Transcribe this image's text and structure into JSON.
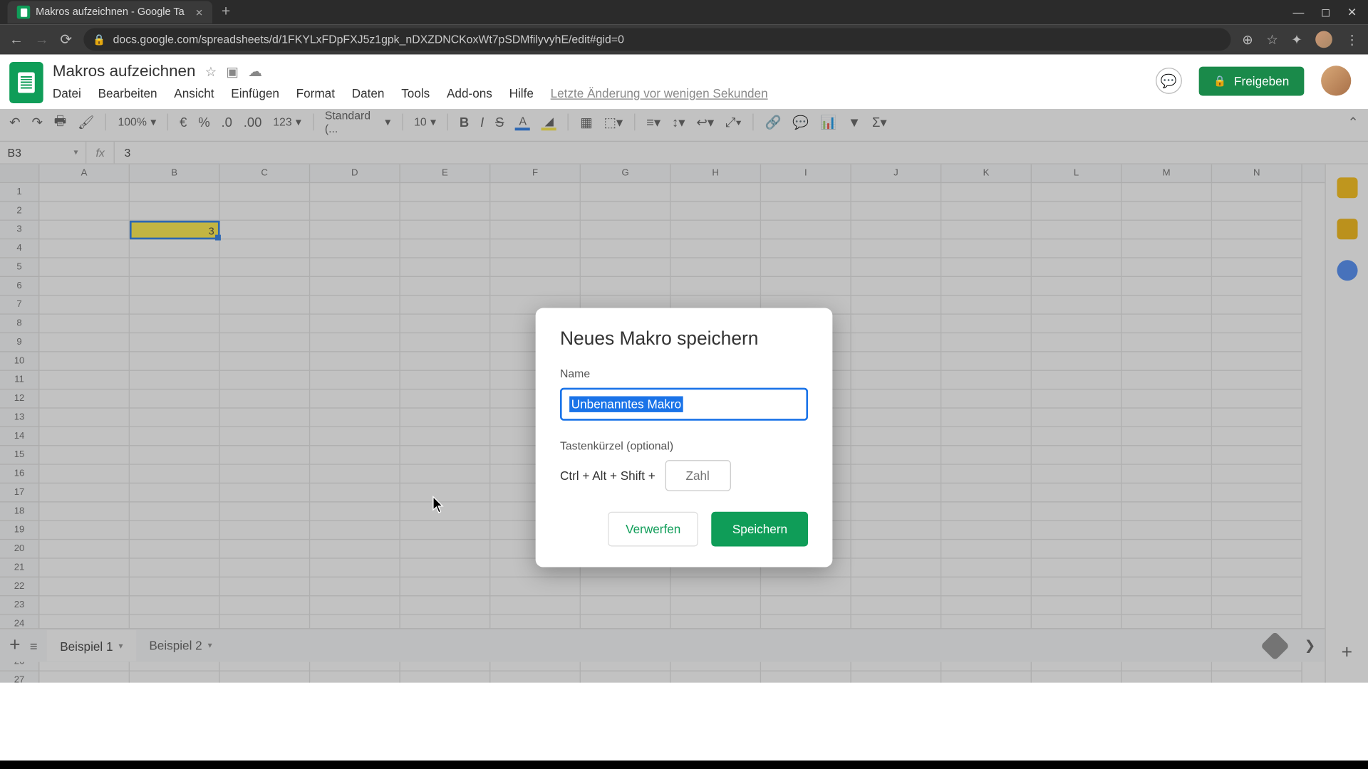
{
  "browser": {
    "tab_title": "Makros aufzeichnen - Google Ta",
    "url": "docs.google.com/spreadsheets/d/1FKYLxFDpFXJ5z1gpk_nDXZDNCKoxWt7pSDMfilyvyhE/edit#gid=0"
  },
  "doc": {
    "title": "Makros aufzeichnen",
    "last_edit": "Letzte Änderung vor wenigen Sekunden"
  },
  "menus": [
    "Datei",
    "Bearbeiten",
    "Ansicht",
    "Einfügen",
    "Format",
    "Daten",
    "Tools",
    "Add-ons",
    "Hilfe"
  ],
  "share_label": "Freigeben",
  "toolbar": {
    "zoom": "100%",
    "currency": "€",
    "percent": "%",
    "dec_dec": ".0",
    "inc_dec": ".00",
    "num_fmt": "123",
    "font_name": "Standard (...",
    "font_size": "10"
  },
  "namebox": "B3",
  "fx_value": "3",
  "columns": [
    "A",
    "B",
    "C",
    "D",
    "E",
    "F",
    "G",
    "H",
    "I",
    "J",
    "K",
    "L",
    "M",
    "N"
  ],
  "row_count": 28,
  "selected_cell": {
    "row": 3,
    "col": "B",
    "value": "3"
  },
  "sheet_tabs": [
    "Beispiel 1",
    "Beispiel 2"
  ],
  "dialog": {
    "title": "Neues Makro speichern",
    "name_label": "Name",
    "name_value": "Unbenanntes Makro",
    "shortcut_label": "Tastenkürzel (optional)",
    "shortcut_prefix": "Ctrl + Alt + Shift +",
    "shortcut_placeholder": "Zahl",
    "discard": "Verwerfen",
    "save": "Speichern"
  }
}
